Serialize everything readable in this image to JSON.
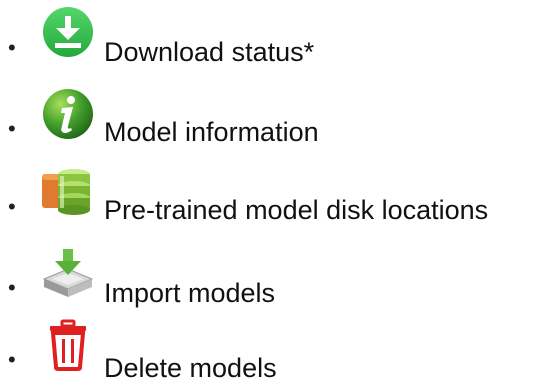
{
  "items": [
    {
      "bullet": "•",
      "label": "Download status*",
      "icon": "download-icon",
      "color": "#2fbf4a"
    },
    {
      "bullet": "•",
      "label": "Model information",
      "icon": "info-icon",
      "color": "#3f9b2a"
    },
    {
      "bullet": "•",
      "label": "Pre-trained model disk locations",
      "icon": "database-icon",
      "color": "#8cc63f"
    },
    {
      "bullet": "•",
      "label": "Import models",
      "icon": "import-icon",
      "color": "#6cc04a"
    },
    {
      "bullet": "•",
      "label": "Delete models",
      "icon": "trash-icon",
      "color": "#e02020"
    }
  ]
}
